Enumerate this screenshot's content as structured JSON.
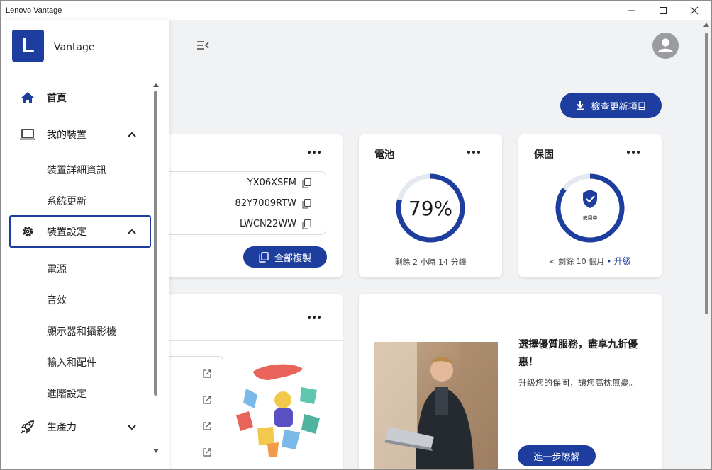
{
  "window": {
    "title": "Lenovo Vantage"
  },
  "sidebar": {
    "logo_letter": "L",
    "brand": "Vantage",
    "nav": [
      {
        "label": "首頁",
        "icon": "home-icon"
      },
      {
        "label": "我的裝置",
        "icon": "laptop-icon",
        "expanded": true
      },
      {
        "label": "裝置設定",
        "icon": "gear-icon",
        "expanded": true
      },
      {
        "label": "生產力",
        "icon": "rocket-icon",
        "expanded": false
      }
    ],
    "device_sub": [
      "裝置詳細資訊",
      "系統更新"
    ],
    "settings_sub": [
      "電源",
      "音效",
      "顯示器和攝影機",
      "輸入和配件",
      "進階設定"
    ]
  },
  "header": {
    "check_update_label": "檢查更新項目"
  },
  "device_card": {
    "ids": [
      "YX06XSFM",
      "82Y7009RTW",
      "LWCN22WW"
    ],
    "copy_all_label": "全部複製"
  },
  "battery_card": {
    "title": "電池",
    "percent_label": "79%",
    "percent": 79,
    "remaining": "剩餘 2 小時 14 分鐘"
  },
  "warranty_card": {
    "title": "保固",
    "status": "使用中",
    "remaining": "< 剩餘 10 個月",
    "separator": "•",
    "upgrade_label": "升級",
    "level": 85
  },
  "promo_card": {
    "title": "選擇優質服務，盡享九折優惠！",
    "description": "升級您的保固，讓您高枕無憂。",
    "learn_more_label": "進一步瞭解"
  },
  "colors": {
    "accent": "#1d3e9e",
    "ring_track": "#e4e8ef"
  }
}
